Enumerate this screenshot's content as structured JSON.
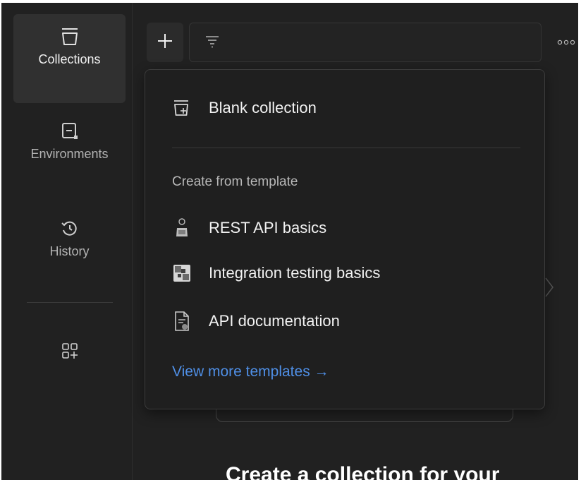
{
  "sidebar": {
    "items": [
      {
        "label": "Collections",
        "icon": "collections-icon",
        "active": true
      },
      {
        "label": "Environments",
        "icon": "environments-icon",
        "active": false
      },
      {
        "label": "History",
        "icon": "history-icon",
        "active": false
      }
    ],
    "add_icon": "add-workspace-view-icon"
  },
  "toolbar": {
    "new_icon": "plus-icon",
    "filter_icon": "filter-icon",
    "more_icon": "more-options-icon"
  },
  "new_menu": {
    "blank_label": "Blank collection",
    "section_label": "Create from template",
    "templates": [
      {
        "label": "REST API basics",
        "icon": "rest-api-template-icon"
      },
      {
        "label": "Integration testing basics",
        "icon": "integration-testing-template-icon"
      },
      {
        "label": "API documentation",
        "icon": "api-documentation-template-icon"
      }
    ],
    "more_link": "View more templates →"
  },
  "main": {
    "empty_heading": "Create a collection for your"
  },
  "colors": {
    "background": "#212121",
    "menu_background": "#1f1f1f",
    "active_item": "#303030",
    "link": "#4f8fe6"
  }
}
